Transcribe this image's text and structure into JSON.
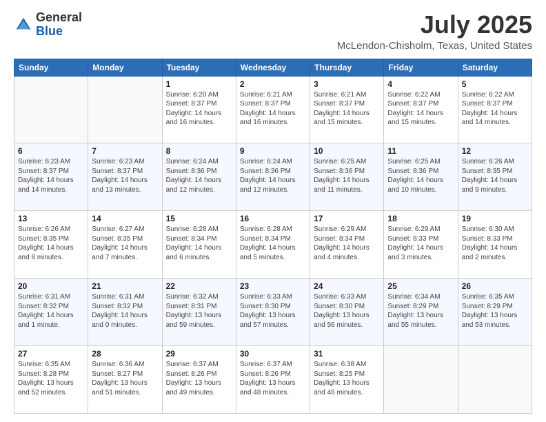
{
  "header": {
    "logo_general": "General",
    "logo_blue": "Blue",
    "month": "July 2025",
    "location": "McLendon-Chisholm, Texas, United States"
  },
  "days_of_week": [
    "Sunday",
    "Monday",
    "Tuesday",
    "Wednesday",
    "Thursday",
    "Friday",
    "Saturday"
  ],
  "weeks": [
    [
      {
        "day": "",
        "sunrise": "",
        "sunset": "",
        "daylight": ""
      },
      {
        "day": "",
        "sunrise": "",
        "sunset": "",
        "daylight": ""
      },
      {
        "day": "1",
        "sunrise": "Sunrise: 6:20 AM",
        "sunset": "Sunset: 8:37 PM",
        "daylight": "Daylight: 14 hours and 16 minutes."
      },
      {
        "day": "2",
        "sunrise": "Sunrise: 6:21 AM",
        "sunset": "Sunset: 8:37 PM",
        "daylight": "Daylight: 14 hours and 16 minutes."
      },
      {
        "day": "3",
        "sunrise": "Sunrise: 6:21 AM",
        "sunset": "Sunset: 8:37 PM",
        "daylight": "Daylight: 14 hours and 15 minutes."
      },
      {
        "day": "4",
        "sunrise": "Sunrise: 6:22 AM",
        "sunset": "Sunset: 8:37 PM",
        "daylight": "Daylight: 14 hours and 15 minutes."
      },
      {
        "day": "5",
        "sunrise": "Sunrise: 6:22 AM",
        "sunset": "Sunset: 8:37 PM",
        "daylight": "Daylight: 14 hours and 14 minutes."
      }
    ],
    [
      {
        "day": "6",
        "sunrise": "Sunrise: 6:23 AM",
        "sunset": "Sunset: 8:37 PM",
        "daylight": "Daylight: 14 hours and 14 minutes."
      },
      {
        "day": "7",
        "sunrise": "Sunrise: 6:23 AM",
        "sunset": "Sunset: 8:37 PM",
        "daylight": "Daylight: 14 hours and 13 minutes."
      },
      {
        "day": "8",
        "sunrise": "Sunrise: 6:24 AM",
        "sunset": "Sunset: 8:36 PM",
        "daylight": "Daylight: 14 hours and 12 minutes."
      },
      {
        "day": "9",
        "sunrise": "Sunrise: 6:24 AM",
        "sunset": "Sunset: 8:36 PM",
        "daylight": "Daylight: 14 hours and 12 minutes."
      },
      {
        "day": "10",
        "sunrise": "Sunrise: 6:25 AM",
        "sunset": "Sunset: 8:36 PM",
        "daylight": "Daylight: 14 hours and 11 minutes."
      },
      {
        "day": "11",
        "sunrise": "Sunrise: 6:25 AM",
        "sunset": "Sunset: 8:36 PM",
        "daylight": "Daylight: 14 hours and 10 minutes."
      },
      {
        "day": "12",
        "sunrise": "Sunrise: 6:26 AM",
        "sunset": "Sunset: 8:35 PM",
        "daylight": "Daylight: 14 hours and 9 minutes."
      }
    ],
    [
      {
        "day": "13",
        "sunrise": "Sunrise: 6:26 AM",
        "sunset": "Sunset: 8:35 PM",
        "daylight": "Daylight: 14 hours and 8 minutes."
      },
      {
        "day": "14",
        "sunrise": "Sunrise: 6:27 AM",
        "sunset": "Sunset: 8:35 PM",
        "daylight": "Daylight: 14 hours and 7 minutes."
      },
      {
        "day": "15",
        "sunrise": "Sunrise: 6:28 AM",
        "sunset": "Sunset: 8:34 PM",
        "daylight": "Daylight: 14 hours and 6 minutes."
      },
      {
        "day": "16",
        "sunrise": "Sunrise: 6:28 AM",
        "sunset": "Sunset: 8:34 PM",
        "daylight": "Daylight: 14 hours and 5 minutes."
      },
      {
        "day": "17",
        "sunrise": "Sunrise: 6:29 AM",
        "sunset": "Sunset: 8:34 PM",
        "daylight": "Daylight: 14 hours and 4 minutes."
      },
      {
        "day": "18",
        "sunrise": "Sunrise: 6:29 AM",
        "sunset": "Sunset: 8:33 PM",
        "daylight": "Daylight: 14 hours and 3 minutes."
      },
      {
        "day": "19",
        "sunrise": "Sunrise: 6:30 AM",
        "sunset": "Sunset: 8:33 PM",
        "daylight": "Daylight: 14 hours and 2 minutes."
      }
    ],
    [
      {
        "day": "20",
        "sunrise": "Sunrise: 6:31 AM",
        "sunset": "Sunset: 8:32 PM",
        "daylight": "Daylight: 14 hours and 1 minute."
      },
      {
        "day": "21",
        "sunrise": "Sunrise: 6:31 AM",
        "sunset": "Sunset: 8:32 PM",
        "daylight": "Daylight: 14 hours and 0 minutes."
      },
      {
        "day": "22",
        "sunrise": "Sunrise: 6:32 AM",
        "sunset": "Sunset: 8:31 PM",
        "daylight": "Daylight: 13 hours and 59 minutes."
      },
      {
        "day": "23",
        "sunrise": "Sunrise: 6:33 AM",
        "sunset": "Sunset: 8:30 PM",
        "daylight": "Daylight: 13 hours and 57 minutes."
      },
      {
        "day": "24",
        "sunrise": "Sunrise: 6:33 AM",
        "sunset": "Sunset: 8:30 PM",
        "daylight": "Daylight: 13 hours and 56 minutes."
      },
      {
        "day": "25",
        "sunrise": "Sunrise: 6:34 AM",
        "sunset": "Sunset: 8:29 PM",
        "daylight": "Daylight: 13 hours and 55 minutes."
      },
      {
        "day": "26",
        "sunrise": "Sunrise: 6:35 AM",
        "sunset": "Sunset: 8:29 PM",
        "daylight": "Daylight: 13 hours and 53 minutes."
      }
    ],
    [
      {
        "day": "27",
        "sunrise": "Sunrise: 6:35 AM",
        "sunset": "Sunset: 8:28 PM",
        "daylight": "Daylight: 13 hours and 52 minutes."
      },
      {
        "day": "28",
        "sunrise": "Sunrise: 6:36 AM",
        "sunset": "Sunset: 8:27 PM",
        "daylight": "Daylight: 13 hours and 51 minutes."
      },
      {
        "day": "29",
        "sunrise": "Sunrise: 6:37 AM",
        "sunset": "Sunset: 8:26 PM",
        "daylight": "Daylight: 13 hours and 49 minutes."
      },
      {
        "day": "30",
        "sunrise": "Sunrise: 6:37 AM",
        "sunset": "Sunset: 8:26 PM",
        "daylight": "Daylight: 13 hours and 48 minutes."
      },
      {
        "day": "31",
        "sunrise": "Sunrise: 6:38 AM",
        "sunset": "Sunset: 8:25 PM",
        "daylight": "Daylight: 13 hours and 46 minutes."
      },
      {
        "day": "",
        "sunrise": "",
        "sunset": "",
        "daylight": ""
      },
      {
        "day": "",
        "sunrise": "",
        "sunset": "",
        "daylight": ""
      }
    ]
  ]
}
